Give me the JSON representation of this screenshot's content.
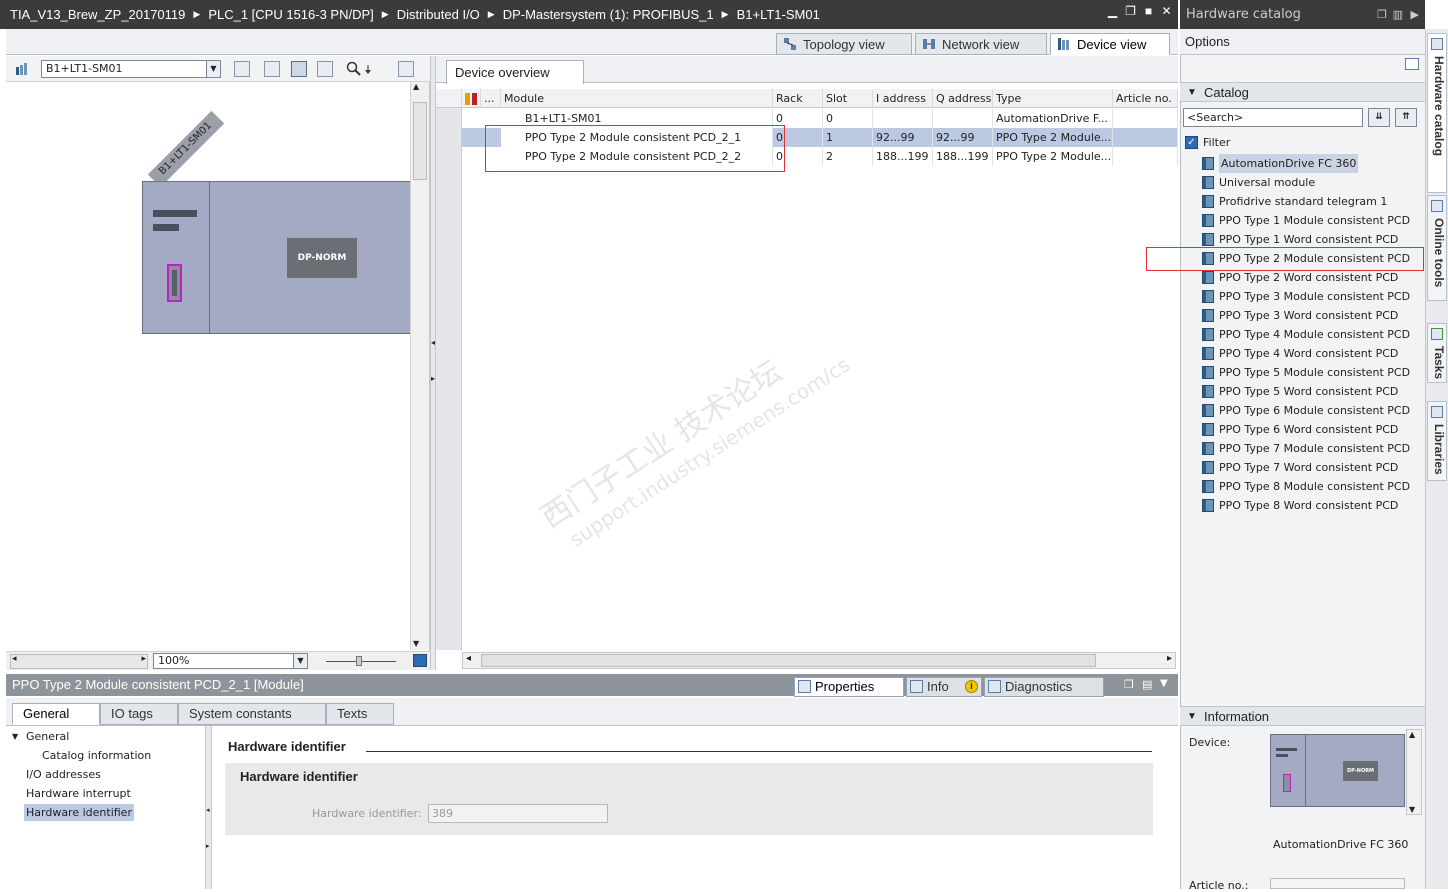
{
  "title": {
    "crumbs": [
      "TIA_V13_Brew_ZP_20170119",
      "PLC_1 [CPU 1516-3 PN/DP]",
      "Distributed I/O",
      "DP-Mastersystem (1): PROFIBUS_1",
      "B1+LT1-SM01"
    ]
  },
  "views": {
    "topology": "Topology view",
    "network": "Network view",
    "device": "Device view"
  },
  "left": {
    "device_select": "B1+LT1-SM01",
    "device_label": "B1+LT1-SM01",
    "module_label": "DP-NORM",
    "zoom": "100%"
  },
  "overview": {
    "tab": "Device overview",
    "columns": {
      "more": "...",
      "module": "Module",
      "rack": "Rack",
      "slot": "Slot",
      "iaddr": "I address",
      "qaddr": "Q address",
      "type": "Type",
      "article": "Article no."
    },
    "rows": [
      {
        "module": "B1+LT1-SM01",
        "rack": "0",
        "slot": "0",
        "iaddr": "",
        "qaddr": "",
        "type": "AutomationDrive F..."
      },
      {
        "module": "PPO Type 2 Module consistent PCD_2_1",
        "rack": "0",
        "slot": "1",
        "iaddr": "92...99",
        "qaddr": "92...99",
        "type": "PPO Type 2 Module..."
      },
      {
        "module": "PPO Type 2 Module consistent PCD_2_2",
        "rack": "0",
        "slot": "2",
        "iaddr": "188...199",
        "qaddr": "188...199",
        "type": "PPO Type 2 Module..."
      }
    ]
  },
  "catalog": {
    "header": "Hardware catalog",
    "options": "Options",
    "catalog_label": "Catalog",
    "search_placeholder": "<Search>",
    "filter": "Filter",
    "items": [
      "AutomationDrive FC 360",
      "Universal module",
      "Profidrive standard telegram 1",
      "PPO Type 1 Module consistent PCD",
      "PPO Type 1 Word consistent PCD",
      "PPO Type 2 Module consistent PCD",
      "PPO Type 2 Word consistent PCD",
      "PPO Type 3 Module consistent PCD",
      "PPO Type 3 Word consistent PCD",
      "PPO Type 4 Module consistent PCD",
      "PPO Type 4 Word consistent PCD",
      "PPO Type 5 Module consistent PCD",
      "PPO Type 5 Word consistent PCD",
      "PPO Type 6 Module consistent PCD",
      "PPO Type 6 Word consistent PCD",
      "PPO Type 7 Module consistent PCD",
      "PPO Type 7 Word consistent PCD",
      "PPO Type 8 Module consistent PCD",
      "PPO Type 8 Word consistent PCD"
    ],
    "information": "Information",
    "device_label": "Device:",
    "device_name": "AutomationDrive FC 360",
    "article_label": "Article no.:"
  },
  "side_tabs": [
    "Hardware catalog",
    "Online tools",
    "Tasks",
    "Libraries"
  ],
  "properties": {
    "title": "PPO Type 2 Module consistent PCD_2_1 [Module]",
    "tabs": [
      "Properties",
      "Info",
      "Diagnostics"
    ],
    "subtabs": [
      "General",
      "IO tags",
      "System constants",
      "Texts"
    ],
    "nav": [
      "General",
      "Catalog information",
      "I/O addresses",
      "Hardware interrupt",
      "Hardware identifier"
    ],
    "section_title": "Hardware identifier",
    "group_title": "Hardware identifier",
    "field_label": "Hardware identifier:",
    "field_value": "389"
  },
  "watermark": {
    "line1": "西门子工业  技术论坛",
    "line2": "support.industry.siemens.com/cs"
  },
  "colors": {
    "titlebar": "#3b3b3b",
    "selection": "#bcc9e2",
    "rack": "#a4aac4",
    "highlight_box": "#e03030",
    "connector": "#c020c0"
  }
}
